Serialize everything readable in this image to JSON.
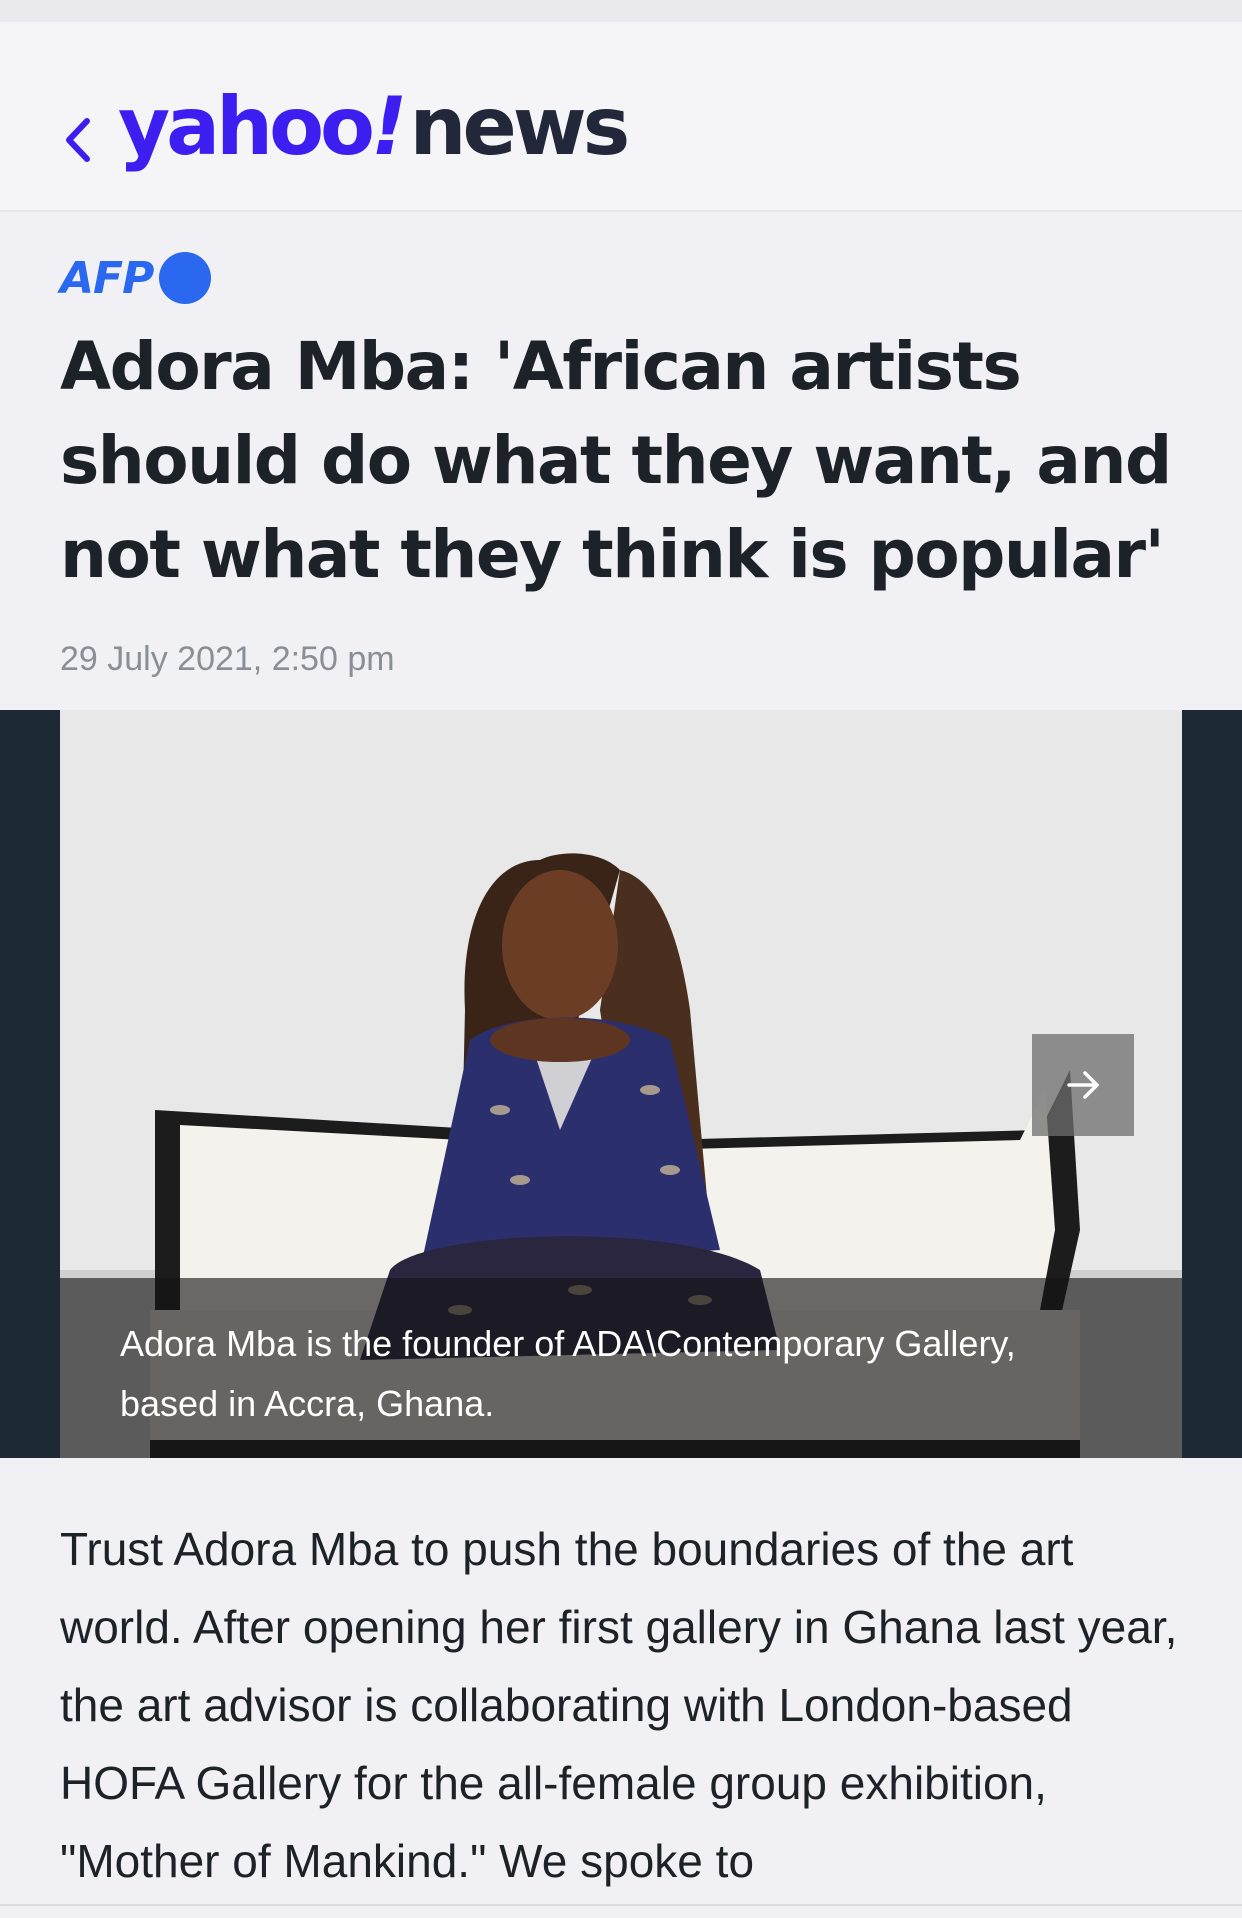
{
  "nav": {
    "back_icon": "chevron-left-icon",
    "logo_brand": "yahoo",
    "logo_bang": "!",
    "logo_section": "news",
    "brand_color": "#3d1ef0"
  },
  "article": {
    "provider": "AFP",
    "provider_color": "#2a68f0",
    "headline": "Adora Mba: 'African artists should do what they want, and not what they think is popular'",
    "timestamp": "29 July 2021, 2:50 pm",
    "image": {
      "caption": "Adora Mba is the founder of ADA\\Contemporary Gallery, based in Accra, Ghana.",
      "next_icon": "arrow-right-icon"
    },
    "body": "Trust Adora Mba to push the boundaries of the art world. After opening her first gallery in Ghana last year, the art advisor is collaborating with London-based HOFA Gallery for the all-female group exhibition, \"Mother of Mankind.\" We spoke to"
  }
}
